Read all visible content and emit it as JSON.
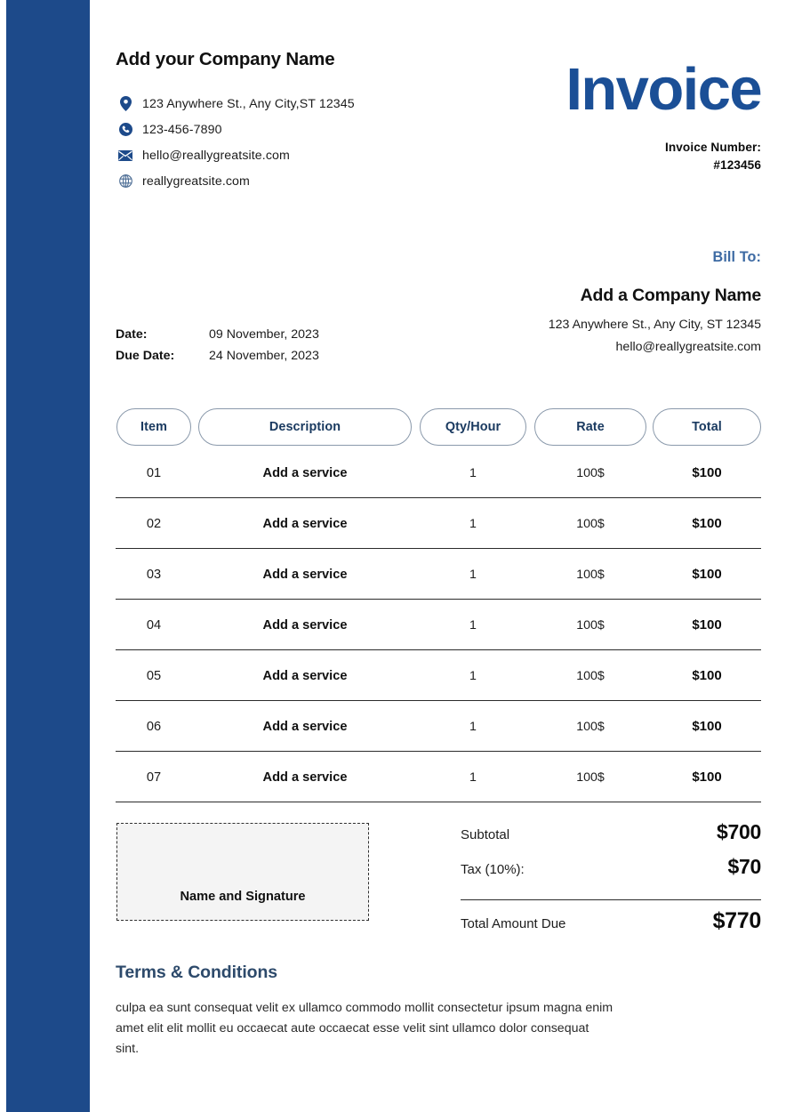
{
  "brand": {
    "bar_color": "#1d4a8a",
    "title_color": "#1b4f96",
    "billto_color": "#3d6aa3",
    "terms_color": "#2d4a6b"
  },
  "header": {
    "company_name": "Add your Company Name",
    "contacts": [
      {
        "icon": "location-pin-icon",
        "text": "123 Anywhere St., Any City,ST 12345"
      },
      {
        "icon": "phone-icon",
        "text": "123-456-7890"
      },
      {
        "icon": "envelope-icon",
        "text": "hello@reallygreatsite.com"
      },
      {
        "icon": "globe-icon",
        "text": "reallygreatsite.com"
      }
    ],
    "invoice_title": "Invoice",
    "invoice_number_label": "Invoice Number:",
    "invoice_number_value": "#123456"
  },
  "bill_to": {
    "label": "Bill To:",
    "company": "Add a Company Name",
    "address": "123 Anywhere St., Any City, ST 12345",
    "email": "hello@reallygreatsite.com"
  },
  "dates": {
    "date_label": "Date:",
    "date_value": "09 November, 2023",
    "due_label": "Due Date:",
    "due_value": "24 November, 2023"
  },
  "table": {
    "columns": [
      "Item",
      "Description",
      "Qty/Hour",
      "Rate",
      "Total"
    ],
    "rows": [
      {
        "item": "01",
        "description": "Add a service",
        "qty": "1",
        "rate": "100$",
        "total": "$100"
      },
      {
        "item": "02",
        "description": "Add a service",
        "qty": "1",
        "rate": "100$",
        "total": "$100"
      },
      {
        "item": "03",
        "description": "Add a service",
        "qty": "1",
        "rate": "100$",
        "total": "$100"
      },
      {
        "item": "04",
        "description": "Add a service",
        "qty": "1",
        "rate": "100$",
        "total": "$100"
      },
      {
        "item": "05",
        "description": "Add a service",
        "qty": "1",
        "rate": "100$",
        "total": "$100"
      },
      {
        "item": "06",
        "description": "Add a service",
        "qty": "1",
        "rate": "100$",
        "total": "$100"
      },
      {
        "item": "07",
        "description": "Add a service",
        "qty": "1",
        "rate": "100$",
        "total": "$100"
      }
    ]
  },
  "signature": {
    "placeholder": "Name and Signature"
  },
  "totals": {
    "subtotal_label": "Subtotal",
    "subtotal_value": "$700",
    "tax_label": "Tax (10%):",
    "tax_value": "$70",
    "grand_label": "Total Amount Due",
    "grand_value": "$770"
  },
  "terms": {
    "title": "Terms & Conditions",
    "body": "culpa ea sunt consequat velit ex ullamco commodo mollit consectetur ipsum magna enim amet elit elit mollit eu occaecat aute occaecat esse velit sint ullamco dolor consequat sint."
  }
}
